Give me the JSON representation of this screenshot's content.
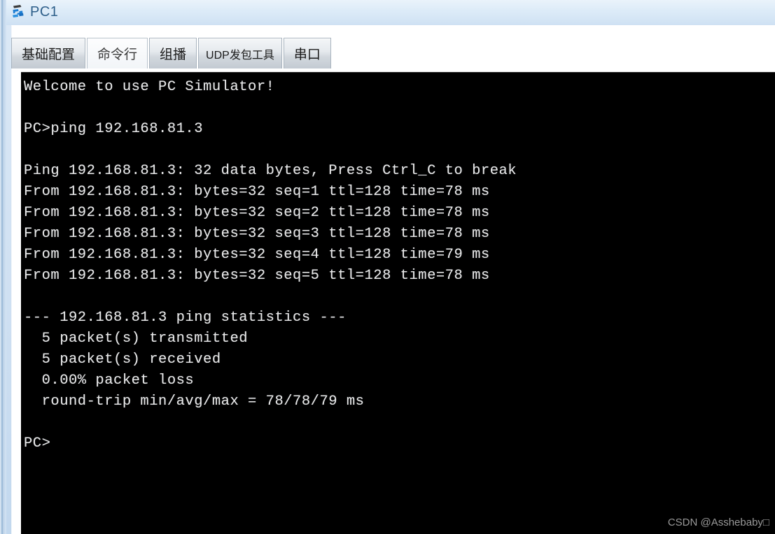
{
  "window": {
    "title": "PC1",
    "icon": "pc-device-icon",
    "title_color": "#2e5f8a",
    "frame_color": "#cfe1f3"
  },
  "tabs": [
    {
      "id": "basic-config",
      "label": "基础配置",
      "active": false
    },
    {
      "id": "command-line",
      "label": "命令行",
      "active": true
    },
    {
      "id": "multicast",
      "label": "组播",
      "active": false
    },
    {
      "id": "udp-packet-tool",
      "label": "UDP发包工具",
      "active": false
    },
    {
      "id": "serial-port",
      "label": "串口",
      "active": false
    }
  ],
  "terminal": {
    "background": "#000000",
    "foreground": "#e9e9e9",
    "lines": [
      "Welcome to use PC Simulator!",
      "",
      "PC>ping 192.168.81.3",
      "",
      "Ping 192.168.81.3: 32 data bytes, Press Ctrl_C to break",
      "From 192.168.81.3: bytes=32 seq=1 ttl=128 time=78 ms",
      "From 192.168.81.3: bytes=32 seq=2 ttl=128 time=78 ms",
      "From 192.168.81.3: bytes=32 seq=3 ttl=128 time=78 ms",
      "From 192.168.81.3: bytes=32 seq=4 ttl=128 time=79 ms",
      "From 192.168.81.3: bytes=32 seq=5 ttl=128 time=78 ms",
      "",
      "--- 192.168.81.3 ping statistics ---",
      "  5 packet(s) transmitted",
      "  5 packet(s) received",
      "  0.00% packet loss",
      "  round-trip min/avg/max = 78/78/79 ms",
      "",
      "PC>"
    ]
  },
  "watermark": {
    "text": "CSDN @Asshebaby□"
  }
}
